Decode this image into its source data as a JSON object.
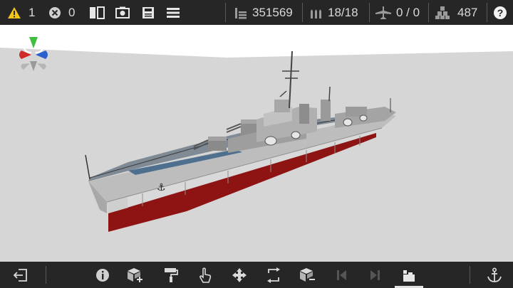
{
  "topbar": {
    "warnings_count": "1",
    "errors_count": "0",
    "cost": "351569",
    "ammo": "18/18",
    "aircraft": "0 / 0",
    "parts": "487",
    "help": "?"
  },
  "icons": {
    "warning": "warning-icon",
    "error": "error-icon",
    "split_view": "split-view-icon",
    "camera": "camera-icon",
    "save": "save-icon",
    "menu": "menu-icon",
    "cost": "coins-icon",
    "ammo": "ammo-icon",
    "aircraft": "airplane-icon",
    "parts": "cubes-icon",
    "help": "help-icon",
    "exit": "exit-icon",
    "info": "info-icon",
    "add_block": "add-block-icon",
    "paint": "paint-roller-icon",
    "select": "hand-pointer-icon",
    "move": "move-arrows-icon",
    "rotate": "rotate-frame-icon",
    "remove_block": "remove-block-icon",
    "previous": "previous-icon",
    "next": "next-icon",
    "sections": "sections-icon",
    "anchor": "anchor-icon"
  },
  "colors": {
    "bar_bg": "#262626",
    "viewport_bg": "#d6d6d6",
    "hull_red": "#8e1414",
    "gizmo_green": "#3fbf3f",
    "gizmo_red": "#d02a2a",
    "gizmo_blue": "#2a5fd0",
    "warning_yellow": "#f0c419"
  }
}
